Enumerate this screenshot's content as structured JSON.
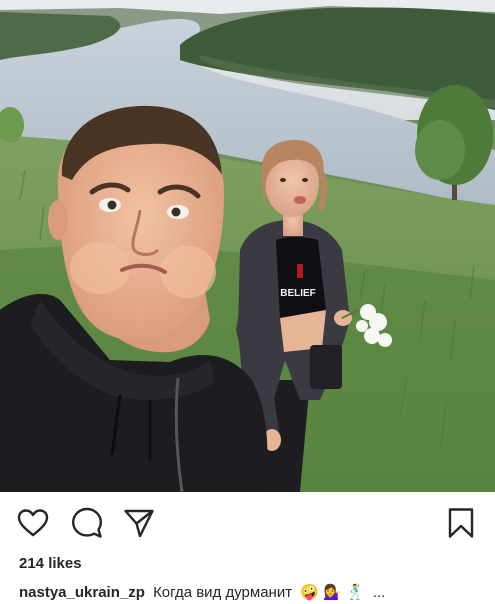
{
  "post": {
    "image_alt": "",
    "likes": "214 likes",
    "caption": {
      "username": "nastya_ukrain_zp",
      "text": "Когда вид дурманит",
      "emojis": "🤪 💁‍♀️ 🕺",
      "ellipsis": "..."
    }
  },
  "actions": {
    "like_icon": "heart-icon",
    "comment_icon": "comment-icon",
    "share_icon": "paper-plane-icon",
    "save_icon": "bookmark-icon"
  },
  "shirt_text": "BELIEF",
  "colors": {
    "text": "#262626",
    "background": "#ffffff"
  }
}
